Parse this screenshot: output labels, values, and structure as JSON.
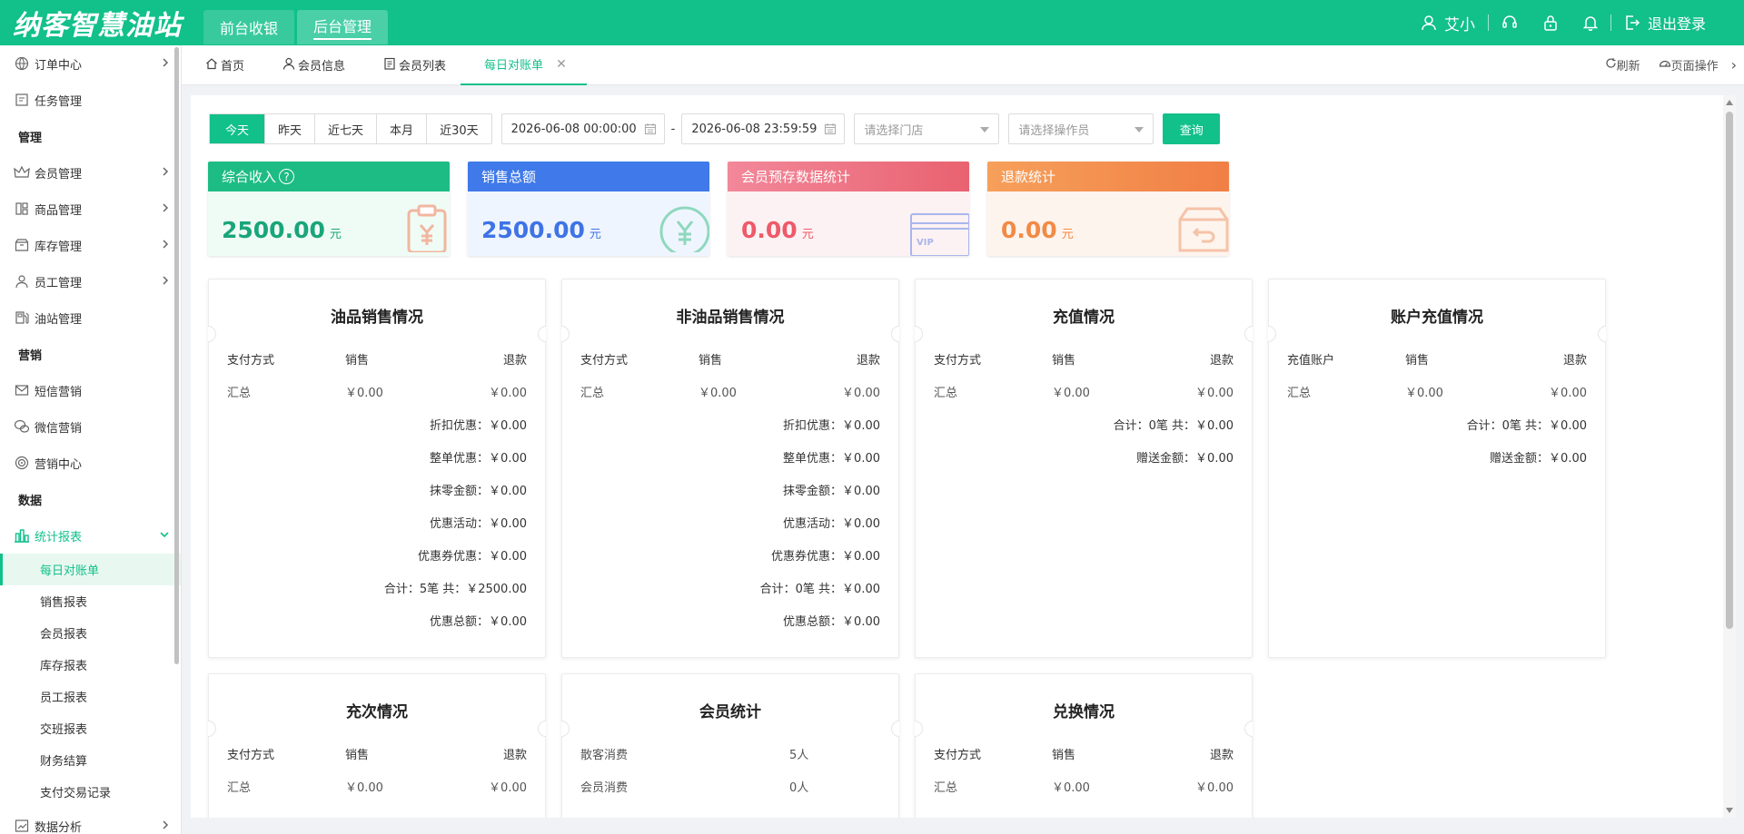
{
  "header": {
    "logo": "纳客智慧油站",
    "tabs": [
      {
        "label": "前台收银",
        "active": false
      },
      {
        "label": "后台管理",
        "active": true
      }
    ],
    "user": "艾小",
    "logout": "退出登录"
  },
  "sidebar": {
    "items": [
      {
        "kind": "item",
        "label": "订单中心",
        "icon": "globe-icon",
        "arrow": ">"
      },
      {
        "kind": "item",
        "label": "任务管理",
        "icon": "task-icon"
      },
      {
        "kind": "group",
        "label": "管理"
      },
      {
        "kind": "item",
        "label": "会员管理",
        "icon": "crown-icon",
        "arrow": ">"
      },
      {
        "kind": "item",
        "label": "商品管理",
        "icon": "goods-icon",
        "arrow": ">"
      },
      {
        "kind": "item",
        "label": "库存管理",
        "icon": "storage-icon",
        "arrow": ">"
      },
      {
        "kind": "item",
        "label": "员工管理",
        "icon": "person-icon",
        "arrow": ">"
      },
      {
        "kind": "item",
        "label": "油站管理",
        "icon": "fuel-pump-icon"
      },
      {
        "kind": "group",
        "label": "营销"
      },
      {
        "kind": "item",
        "label": "短信营销",
        "icon": "mail-icon"
      },
      {
        "kind": "item",
        "label": "微信营销",
        "icon": "wechat-icon"
      },
      {
        "kind": "item",
        "label": "营销中心",
        "icon": "target-icon"
      },
      {
        "kind": "group",
        "label": "数据"
      },
      {
        "kind": "item",
        "label": "统计报表",
        "icon": "bar-chart-icon",
        "arrow": "v",
        "open": true
      },
      {
        "kind": "sub",
        "label": "每日对账单",
        "active": true
      },
      {
        "kind": "sub",
        "label": "销售报表"
      },
      {
        "kind": "sub",
        "label": "会员报表"
      },
      {
        "kind": "sub",
        "label": "库存报表"
      },
      {
        "kind": "sub",
        "label": "员工报表"
      },
      {
        "kind": "sub",
        "label": "交班报表"
      },
      {
        "kind": "sub",
        "label": "财务结算"
      },
      {
        "kind": "sub",
        "label": "支付交易记录"
      },
      {
        "kind": "item",
        "label": "数据分析",
        "icon": "analytics-icon",
        "arrow": ">"
      }
    ]
  },
  "tabs": {
    "items": [
      {
        "label": "首页",
        "icon": "home-icon"
      },
      {
        "label": "会员信息",
        "icon": "user-icon"
      },
      {
        "label": "会员列表",
        "icon": "list-icon"
      },
      {
        "label": "每日对账单",
        "active": true,
        "closable": true
      }
    ],
    "refresh": "刷新",
    "page_ops": "页面操作"
  },
  "filters": {
    "quick": [
      "今天",
      "昨天",
      "近七天",
      "本月",
      "近30天"
    ],
    "start": "2026-06-08 00:00:00",
    "dash": "-",
    "end": "2026-06-08 23:59:59",
    "store_placeholder": "请选择门店",
    "operator_placeholder": "请选择操作员",
    "query": "查询"
  },
  "stats": [
    {
      "title": "综合收入",
      "value": "2500.00",
      "unit": "元",
      "help": "?"
    },
    {
      "title": "销售总额",
      "value": "2500.00",
      "unit": "元"
    },
    {
      "title": "会员预存数据统计",
      "value": "0.00",
      "unit": "元",
      "badge": "VIP"
    },
    {
      "title": "退款统计",
      "value": "0.00",
      "unit": "元"
    }
  ],
  "panels": {
    "oil": {
      "title": "油品销售情况",
      "head": [
        "支付方式",
        "销售",
        "退款"
      ],
      "row": [
        "汇总",
        "￥0.00",
        "￥0.00"
      ],
      "lines": [
        "折扣优惠：￥0.00",
        "整单优惠：￥0.00",
        "抹零金额：￥0.00",
        "优惠活动：￥0.00",
        "优惠券优惠：￥0.00",
        "合计：5笔 共：￥2500.00",
        "优惠总额：￥0.00"
      ]
    },
    "nonoil": {
      "title": "非油品销售情况",
      "head": [
        "支付方式",
        "销售",
        "退款"
      ],
      "row": [
        "汇总",
        "￥0.00",
        "￥0.00"
      ],
      "lines": [
        "折扣优惠：￥0.00",
        "整单优惠：￥0.00",
        "抹零金额：￥0.00",
        "优惠活动：￥0.00",
        "优惠券优惠：￥0.00",
        "合计：0笔 共：￥0.00",
        "优惠总额：￥0.00"
      ]
    },
    "recharge": {
      "title": "充值情况",
      "head": [
        "支付方式",
        "销售",
        "退款"
      ],
      "row": [
        "汇总",
        "￥0.00",
        "￥0.00"
      ],
      "lines": [
        "合计：0笔 共：￥0.00",
        "赠送金额：￥0.00"
      ]
    },
    "account": {
      "title": "账户充值情况",
      "head": [
        "充值账户",
        "销售",
        "退款"
      ],
      "row": [
        "汇总",
        "￥0.00",
        "￥0.00"
      ],
      "lines": [
        "合计：0笔 共：￥0.00",
        "赠送金额：￥0.00"
      ]
    },
    "times": {
      "title": "充次情况",
      "head": [
        "支付方式",
        "销售",
        "退款"
      ],
      "row": [
        "汇总",
        "￥0.00",
        "￥0.00"
      ]
    },
    "member": {
      "title": "会员统计",
      "rows": [
        [
          "散客消费",
          "5人"
        ],
        [
          "会员消费",
          "0人"
        ]
      ]
    },
    "exchange": {
      "title": "兑换情况",
      "head": [
        "支付方式",
        "销售",
        "退款"
      ],
      "row": [
        "汇总",
        "￥0.00",
        "￥0.00"
      ]
    }
  },
  "colors": {
    "brand": "#12c08a",
    "card_income": "#1ebc85",
    "card_sales": "#3f79ea",
    "card_prestore": "#e96270",
    "card_refund": "#f17f46"
  }
}
